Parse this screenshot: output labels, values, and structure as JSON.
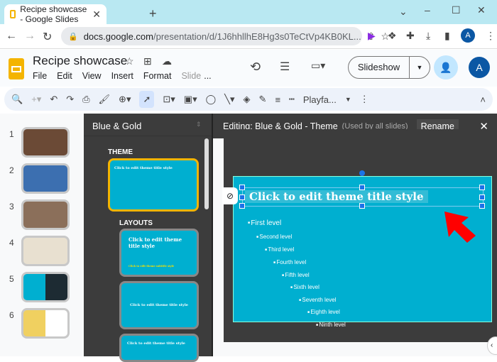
{
  "browser": {
    "tab_title": "Recipe showcase - Google Slides",
    "url_domain": "docs.google.com",
    "url_path": "/presentation/d/1J6hhllhE8Hg3s0TeCtVp4KB0KL...",
    "profile": "A"
  },
  "app": {
    "title": "Recipe showcase",
    "menu": [
      "File",
      "Edit",
      "View",
      "Insert",
      "Format",
      "Slide",
      "..."
    ],
    "slideshow": "Slideshow",
    "avatar": "A",
    "font": "Playfa..."
  },
  "filmstrip": {
    "slides": [
      {
        "n": "1",
        "color": "#6b4a36"
      },
      {
        "n": "2",
        "color": "#3c6fb0"
      },
      {
        "n": "3",
        "color": "#8b6f5a"
      },
      {
        "n": "4",
        "color": "#e8e0d0"
      },
      {
        "n": "5",
        "color": "#00afd0"
      },
      {
        "n": "6",
        "color": "#f0e6c8"
      }
    ]
  },
  "theme_panel": {
    "name": "Blue & Gold",
    "theme_label": "THEME",
    "layouts_label": "LAYOUTS",
    "thumb_title": "Click to edit theme title style",
    "subtitle": "Click to edit theme subtitle style"
  },
  "editor": {
    "title": "Editing: Blue & Gold - Theme",
    "subtitle": "(Used by all slides)",
    "rename": "Rename",
    "slide_title": "Click to edit theme title style",
    "levels": [
      "First level",
      "Second level",
      "Third level",
      "Fourth level",
      "Fifth level",
      "Sixth level",
      "Seventh level",
      "Eighth level",
      "Ninth level"
    ]
  }
}
